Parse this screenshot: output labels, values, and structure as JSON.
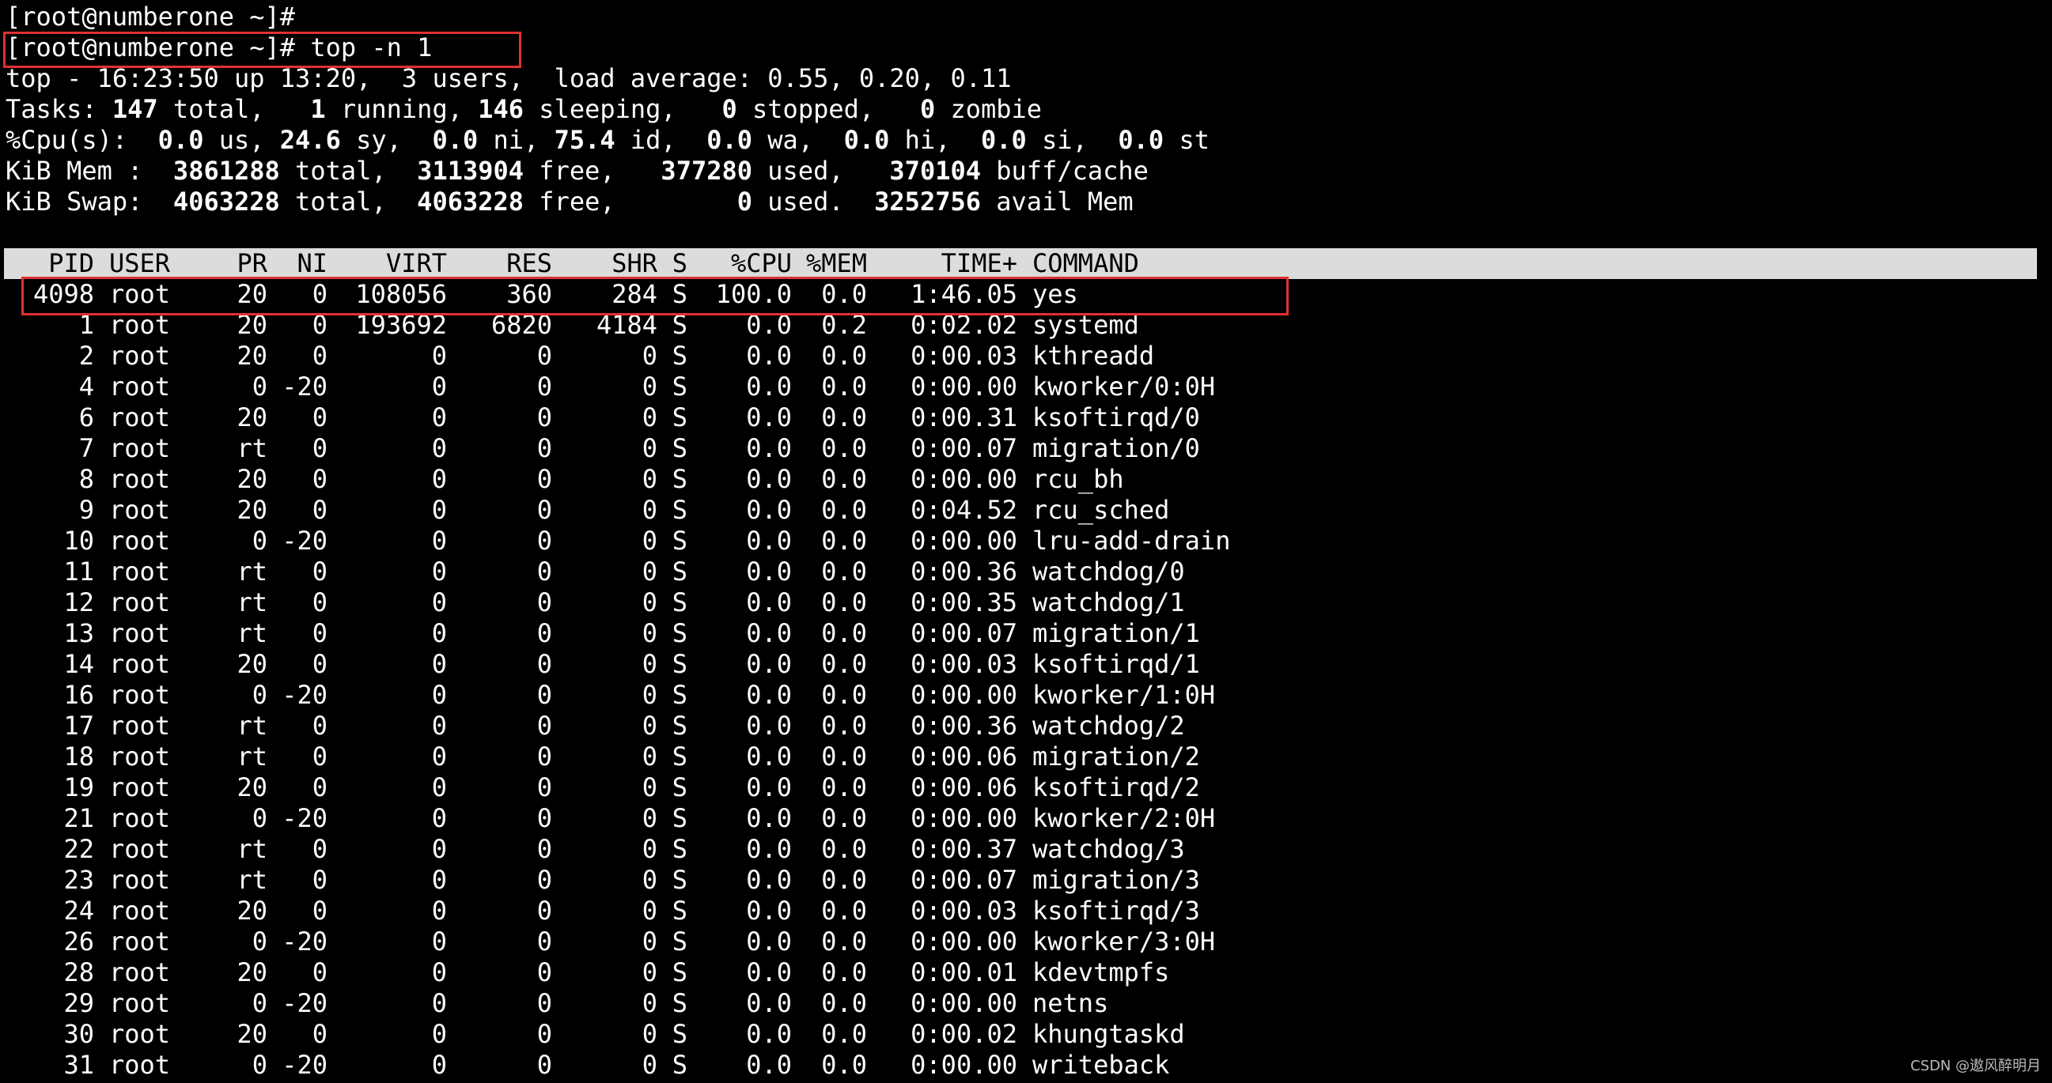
{
  "prompt_lines": [
    "[root@numberone ~]#",
    "[root@numberone ~]# top -n 1"
  ],
  "summary": {
    "uptime_line": "top - 16:23:50 up 13:20,  3 users,  load average: 0.55, 0.20, 0.11",
    "tasks": {
      "label": "Tasks:",
      "total": "147",
      "total_label": "total,",
      "running": "1",
      "running_label": "running,",
      "sleeping": "146",
      "sleeping_label": "sleeping,",
      "stopped": "0",
      "stopped_label": "stopped,",
      "zombie": "0",
      "zombie_label": "zombie"
    },
    "cpu": {
      "label": "%Cpu(s):",
      "us": "0.0",
      "us_label": "us,",
      "sy": "24.6",
      "sy_label": "sy,",
      "ni": "0.0",
      "ni_label": "ni,",
      "id": "75.4",
      "id_label": "id,",
      "wa": "0.0",
      "wa_label": "wa,",
      "hi": "0.0",
      "hi_label": "hi,",
      "si": "0.0",
      "si_label": "si,",
      "st": "0.0",
      "st_label": "st"
    },
    "mem": {
      "label": "KiB Mem :",
      "total": "3861288",
      "total_label": "total,",
      "free": "3113904",
      "free_label": "free,",
      "used": "377280",
      "used_label": "used,",
      "buff": "370104",
      "buff_label": "buff/cache"
    },
    "swap": {
      "label": "KiB Swap:",
      "total": "4063228",
      "total_label": "total,",
      "free": "4063228",
      "free_label": "free,",
      "used": "0",
      "used_label": "used.",
      "avail": "3252756",
      "avail_label": "avail Mem"
    }
  },
  "table": {
    "columns": [
      "PID",
      "USER",
      "PR",
      "NI",
      "VIRT",
      "RES",
      "SHR",
      "S",
      "%CPU",
      "%MEM",
      "TIME+",
      "COMMAND"
    ],
    "rows": [
      [
        "4098",
        "root",
        "20",
        "0",
        "108056",
        "360",
        "284",
        "S",
        "100.0",
        "0.0",
        "1:46.05",
        "yes"
      ],
      [
        "1",
        "root",
        "20",
        "0",
        "193692",
        "6820",
        "4184",
        "S",
        "0.0",
        "0.2",
        "0:02.02",
        "systemd"
      ],
      [
        "2",
        "root",
        "20",
        "0",
        "0",
        "0",
        "0",
        "S",
        "0.0",
        "0.0",
        "0:00.03",
        "kthreadd"
      ],
      [
        "4",
        "root",
        "0",
        "-20",
        "0",
        "0",
        "0",
        "S",
        "0.0",
        "0.0",
        "0:00.00",
        "kworker/0:0H"
      ],
      [
        "6",
        "root",
        "20",
        "0",
        "0",
        "0",
        "0",
        "S",
        "0.0",
        "0.0",
        "0:00.31",
        "ksoftirqd/0"
      ],
      [
        "7",
        "root",
        "rt",
        "0",
        "0",
        "0",
        "0",
        "S",
        "0.0",
        "0.0",
        "0:00.07",
        "migration/0"
      ],
      [
        "8",
        "root",
        "20",
        "0",
        "0",
        "0",
        "0",
        "S",
        "0.0",
        "0.0",
        "0:00.00",
        "rcu_bh"
      ],
      [
        "9",
        "root",
        "20",
        "0",
        "0",
        "0",
        "0",
        "S",
        "0.0",
        "0.0",
        "0:04.52",
        "rcu_sched"
      ],
      [
        "10",
        "root",
        "0",
        "-20",
        "0",
        "0",
        "0",
        "S",
        "0.0",
        "0.0",
        "0:00.00",
        "lru-add-drain"
      ],
      [
        "11",
        "root",
        "rt",
        "0",
        "0",
        "0",
        "0",
        "S",
        "0.0",
        "0.0",
        "0:00.36",
        "watchdog/0"
      ],
      [
        "12",
        "root",
        "rt",
        "0",
        "0",
        "0",
        "0",
        "S",
        "0.0",
        "0.0",
        "0:00.35",
        "watchdog/1"
      ],
      [
        "13",
        "root",
        "rt",
        "0",
        "0",
        "0",
        "0",
        "S",
        "0.0",
        "0.0",
        "0:00.07",
        "migration/1"
      ],
      [
        "14",
        "root",
        "20",
        "0",
        "0",
        "0",
        "0",
        "S",
        "0.0",
        "0.0",
        "0:00.03",
        "ksoftirqd/1"
      ],
      [
        "16",
        "root",
        "0",
        "-20",
        "0",
        "0",
        "0",
        "S",
        "0.0",
        "0.0",
        "0:00.00",
        "kworker/1:0H"
      ],
      [
        "17",
        "root",
        "rt",
        "0",
        "0",
        "0",
        "0",
        "S",
        "0.0",
        "0.0",
        "0:00.36",
        "watchdog/2"
      ],
      [
        "18",
        "root",
        "rt",
        "0",
        "0",
        "0",
        "0",
        "S",
        "0.0",
        "0.0",
        "0:00.06",
        "migration/2"
      ],
      [
        "19",
        "root",
        "20",
        "0",
        "0",
        "0",
        "0",
        "S",
        "0.0",
        "0.0",
        "0:00.06",
        "ksoftirqd/2"
      ],
      [
        "21",
        "root",
        "0",
        "-20",
        "0",
        "0",
        "0",
        "S",
        "0.0",
        "0.0",
        "0:00.00",
        "kworker/2:0H"
      ],
      [
        "22",
        "root",
        "rt",
        "0",
        "0",
        "0",
        "0",
        "S",
        "0.0",
        "0.0",
        "0:00.37",
        "watchdog/3"
      ],
      [
        "23",
        "root",
        "rt",
        "0",
        "0",
        "0",
        "0",
        "S",
        "0.0",
        "0.0",
        "0:00.07",
        "migration/3"
      ],
      [
        "24",
        "root",
        "20",
        "0",
        "0",
        "0",
        "0",
        "S",
        "0.0",
        "0.0",
        "0:00.03",
        "ksoftirqd/3"
      ],
      [
        "26",
        "root",
        "0",
        "-20",
        "0",
        "0",
        "0",
        "S",
        "0.0",
        "0.0",
        "0:00.00",
        "kworker/3:0H"
      ],
      [
        "28",
        "root",
        "20",
        "0",
        "0",
        "0",
        "0",
        "S",
        "0.0",
        "0.0",
        "0:00.01",
        "kdevtmpfs"
      ],
      [
        "29",
        "root",
        "0",
        "-20",
        "0",
        "0",
        "0",
        "S",
        "0.0",
        "0.0",
        "0:00.00",
        "netns"
      ],
      [
        "30",
        "root",
        "20",
        "0",
        "0",
        "0",
        "0",
        "S",
        "0.0",
        "0.0",
        "0:00.02",
        "khungtaskd"
      ],
      [
        "31",
        "root",
        "0",
        "-20",
        "0",
        "0",
        "0",
        "S",
        "0.0",
        "0.0",
        "0:00.00",
        "writeback"
      ]
    ]
  },
  "annotation_color": "#e03131",
  "watermark": "CSDN @遨风醉明月"
}
